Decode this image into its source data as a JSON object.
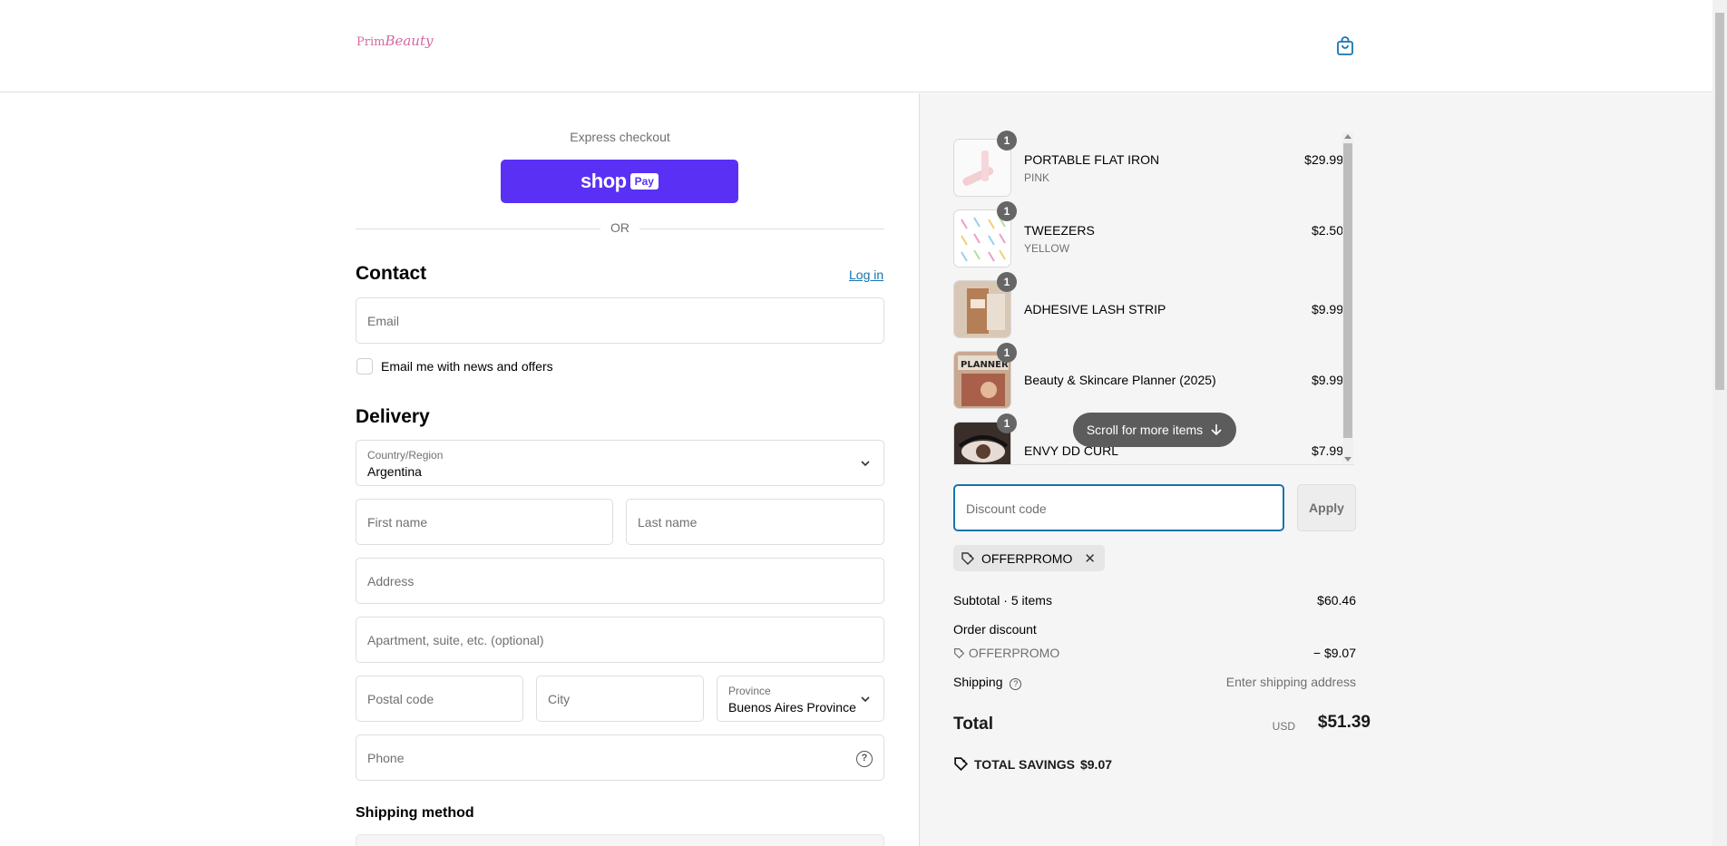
{
  "header": {
    "logo_main": "Prim",
    "logo_script": "Beauty",
    "cart_icon": "bag-icon"
  },
  "express": {
    "label": "Express checkout",
    "shop_word": "shop",
    "pay_word": "Pay",
    "or": "OR"
  },
  "contact": {
    "title": "Contact",
    "login": "Log in",
    "email_placeholder": "Email",
    "newsletter_label": "Email me with news and offers"
  },
  "delivery": {
    "title": "Delivery",
    "country_label": "Country/Region",
    "country_value": "Argentina",
    "first_name": "First name",
    "last_name": "Last name",
    "address": "Address",
    "apartment": "Apartment, suite, etc. (optional)",
    "postal": "Postal code",
    "city": "City",
    "province_label": "Province",
    "province_value": "Buenos Aires Province",
    "phone": "Phone"
  },
  "shipping_method": {
    "title": "Shipping method"
  },
  "cart": {
    "items": [
      {
        "qty": "1",
        "name": "PORTABLE FLAT IRON",
        "variant": "PINK",
        "price": "$29.99"
      },
      {
        "qty": "1",
        "name": "TWEEZERS",
        "variant": "YELLOW",
        "price": "$2.50"
      },
      {
        "qty": "1",
        "name": "ADHESIVE LASH STRIP",
        "variant": "",
        "price": "$9.99"
      },
      {
        "qty": "1",
        "name": "Beauty & Skincare Planner (2025)",
        "variant": "",
        "price": "$9.99"
      },
      {
        "qty": "1",
        "name": "ENVY DD CURL",
        "variant": "",
        "price": "$7.99"
      }
    ],
    "scroll_hint": "Scroll for more items"
  },
  "discount": {
    "placeholder": "Discount code",
    "apply": "Apply",
    "applied_code": "OFFERPROMO"
  },
  "summary": {
    "subtotal_label": "Subtotal · 5 items",
    "subtotal_value": "$60.46",
    "order_discount_label": "Order discount",
    "discount_code": "OFFERPROMO",
    "discount_value": "− $9.07",
    "shipping_label": "Shipping",
    "shipping_value": "Enter shipping address",
    "total_label": "Total",
    "currency": "USD",
    "total_value": "$51.39",
    "savings_label": "TOTAL SAVINGS",
    "savings_value": "$9.07"
  },
  "colors": {
    "shoppay": "#5a31f4",
    "link": "#1773b0",
    "logo": "#d36aa0"
  }
}
